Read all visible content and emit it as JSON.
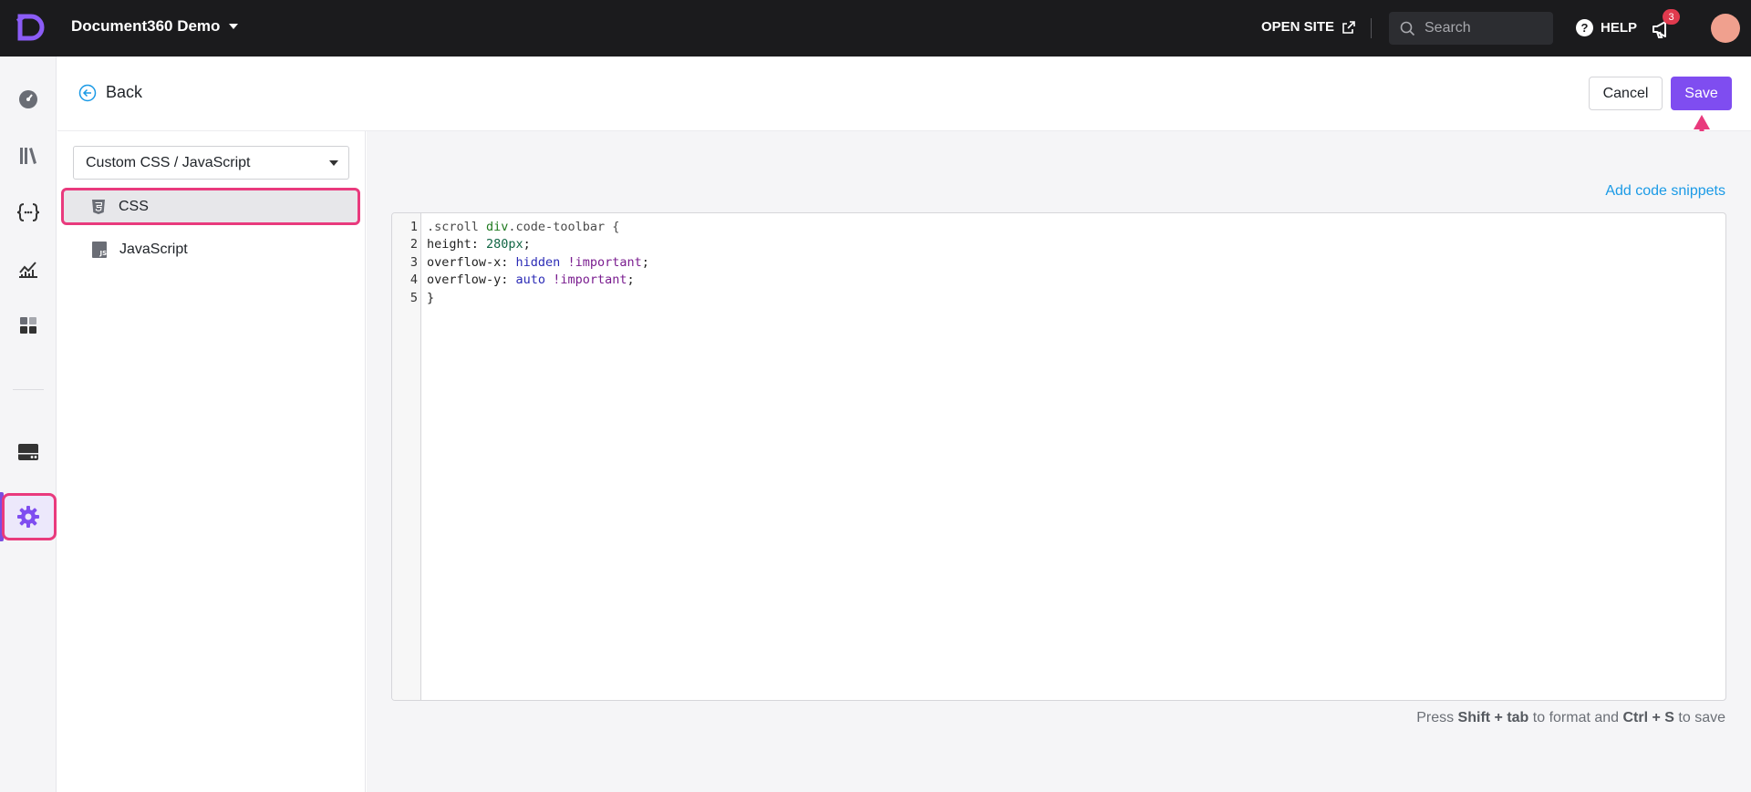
{
  "topbar": {
    "project_name": "Document360 Demo",
    "open_site_label": "OPEN SITE",
    "search_placeholder": "Search",
    "help_label": "HELP",
    "notification_count": "3"
  },
  "rail": {
    "items": [
      {
        "icon": "dashboard-icon"
      },
      {
        "icon": "documentation-icon"
      },
      {
        "icon": "api-docs-icon"
      },
      {
        "icon": "analytics-icon"
      },
      {
        "icon": "apps-icon"
      },
      {
        "icon": "drive-icon"
      },
      {
        "icon": "settings-icon",
        "active": true
      }
    ]
  },
  "header": {
    "back_label": "Back",
    "cancel_label": "Cancel",
    "save_label": "Save"
  },
  "subnav": {
    "dropdown_value": "Custom CSS / JavaScript",
    "items": [
      {
        "label": "CSS",
        "icon": "css3-icon",
        "selected": true
      },
      {
        "label": "JavaScript",
        "icon": "js-file-icon",
        "selected": false
      }
    ]
  },
  "editor": {
    "add_snippets_label": "Add code snippets",
    "line_numbers": [
      "1",
      "2",
      "3",
      "4",
      "5"
    ],
    "lines": [
      [
        {
          "t": ".scroll ",
          "c": "sel"
        },
        {
          "t": "div",
          "c": "tag"
        },
        {
          "t": ".code-toolbar {",
          "c": "sel"
        }
      ],
      [
        {
          "t": "height: ",
          "c": "plain"
        },
        {
          "t": "280px",
          "c": "num"
        },
        {
          "t": ";",
          "c": "plain"
        }
      ],
      [
        {
          "t": "overflow-x: ",
          "c": "plain"
        },
        {
          "t": "hidden",
          "c": "kw"
        },
        {
          "t": " ",
          "c": "plain"
        },
        {
          "t": "!important",
          "c": "imp"
        },
        {
          "t": ";",
          "c": "plain"
        }
      ],
      [
        {
          "t": "overflow-y: ",
          "c": "plain"
        },
        {
          "t": "auto",
          "c": "kw"
        },
        {
          "t": " ",
          "c": "plain"
        },
        {
          "t": "!important",
          "c": "imp"
        },
        {
          "t": ";",
          "c": "plain"
        }
      ],
      [
        {
          "t": "}",
          "c": "plain"
        }
      ]
    ]
  },
  "hint": {
    "prefix": "Press ",
    "key1": "Shift + tab",
    "middle": " to format and ",
    "key2": "Ctrl + S",
    "suffix": " to save"
  },
  "colors": {
    "brand": "#7f4df0",
    "highlight": "#e93a7d",
    "link": "#1a9ae6",
    "topbar": "#1b1b1d"
  }
}
